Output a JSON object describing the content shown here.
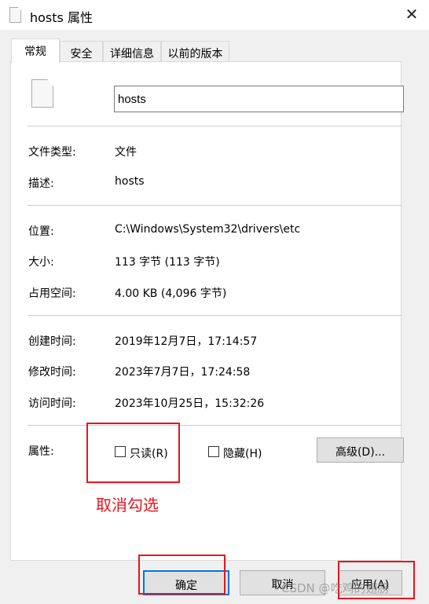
{
  "window": {
    "title": "hosts 属性",
    "close_icon": "close-icon"
  },
  "tabs": [
    {
      "label": "常规",
      "active": true
    },
    {
      "label": "安全"
    },
    {
      "label": "详细信息"
    },
    {
      "label": "以前的版本"
    }
  ],
  "general": {
    "file_name": "hosts",
    "rows": [
      {
        "label": "文件类型:",
        "value": "文件"
      },
      {
        "label": "描述:",
        "value": "hosts"
      },
      {
        "label": "位置:",
        "value": "C:\\Windows\\System32\\drivers\\etc"
      },
      {
        "label": "大小:",
        "value": "113 字节 (113 字节)"
      },
      {
        "label": "占用空间:",
        "value": "4.00 KB (4,096 字节)"
      },
      {
        "label": "创建时间:",
        "value": "2019年12月7日，17:14:57"
      },
      {
        "label": "修改时间:",
        "value": "2023年7月7日，17:24:58"
      },
      {
        "label": "访问时间:",
        "value": "2023年10月25日，15:32:26"
      }
    ],
    "attributes_label": "属性:",
    "readonly": {
      "label": "只读(R)",
      "checked": false
    },
    "hidden": {
      "label": "隐藏(H)",
      "checked": false
    },
    "advanced_label": "高级(D)..."
  },
  "buttons": {
    "ok": "确定",
    "cancel": "取消",
    "apply": "应用(A)"
  },
  "annotation": {
    "text": "取消勾选",
    "color": "#e8141c"
  },
  "watermark": "CSDN @吃鸡的翅膀"
}
